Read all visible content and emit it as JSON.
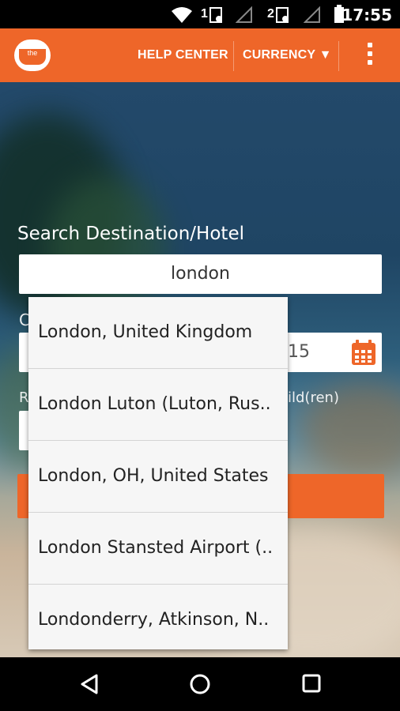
{
  "status_bar": {
    "time": "17:55",
    "sim1_label": "1",
    "sim2_label": "2"
  },
  "app_bar": {
    "logo_text": "the",
    "help_center": "HELP CENTER",
    "currency": "CURRENCY ▼"
  },
  "search": {
    "label": "Search Destination/Hotel",
    "value": "london",
    "checkin_partial": "C",
    "date_partial": "15",
    "rooms_partial": "R",
    "children_partial": "ild(ren)"
  },
  "suggestions": [
    "London, United Kingdom",
    "London Luton (Luton, Rus..",
    "London, OH, United States",
    "London Stansted Airport (..",
    "Londonderry, Atkinson, N.."
  ],
  "colors": {
    "accent": "#ee6629",
    "calendar_icon": "#ee6629"
  },
  "icons": [
    "wifi-icon",
    "signal-icon",
    "battery-icon",
    "overflow-menu-icon",
    "calendar-icon",
    "back-icon",
    "home-icon",
    "recents-icon"
  ]
}
